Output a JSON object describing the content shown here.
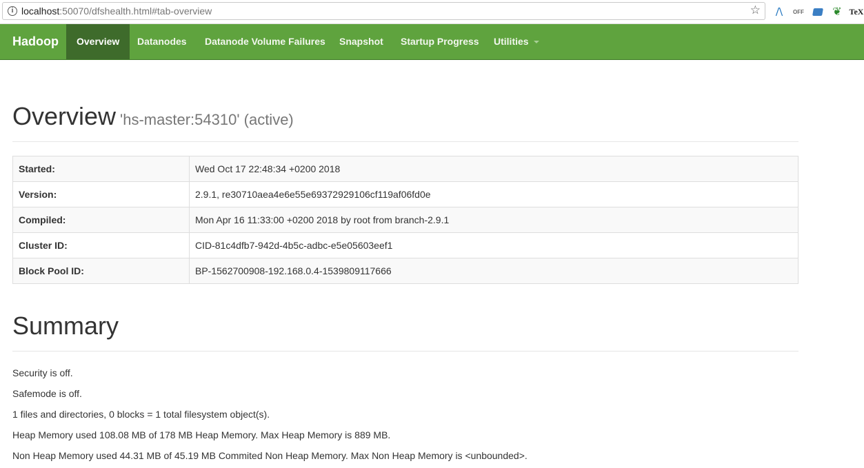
{
  "browser": {
    "url_host": "localhost",
    "url_rest": ":50070/dfshealth.html#tab-overview",
    "extensions": [
      "mendeley-icon",
      "office-icon",
      "zotero-icon",
      "evernote-icon",
      "tex-icon"
    ],
    "ext_text": {
      "office": "OFF",
      "tex": "TeX",
      "mendeley": "/\\"
    }
  },
  "navbar": {
    "brand": "Hadoop",
    "items": [
      {
        "label": "Overview",
        "active": true
      },
      {
        "label": "Datanodes"
      },
      {
        "label": "Datanode Volume Failures"
      },
      {
        "label": "Snapshot"
      },
      {
        "label": "Startup Progress"
      },
      {
        "label": "Utilities",
        "dropdown": true
      }
    ],
    "color": "#5fa33e",
    "active_color": "#3e6b2b"
  },
  "overview": {
    "title": "Overview",
    "subtitle": "'hs-master:54310' (active)",
    "rows": [
      {
        "key": "Started:",
        "value": "Wed Oct 17 22:48:34 +0200 2018"
      },
      {
        "key": "Version:",
        "value": "2.9.1, re30710aea4e6e55e69372929106cf119af06fd0e"
      },
      {
        "key": "Compiled:",
        "value": "Mon Apr 16 11:33:00 +0200 2018 by root from branch-2.9.1"
      },
      {
        "key": "Cluster ID:",
        "value": "CID-81c4dfb7-942d-4b5c-adbc-e5e05603eef1"
      },
      {
        "key": "Block Pool ID:",
        "value": "BP-1562700908-192.168.0.4-1539809117666"
      }
    ]
  },
  "summary": {
    "title": "Summary",
    "lines": [
      "Security is off.",
      "Safemode is off.",
      "1 files and directories, 0 blocks = 1 total filesystem object(s).",
      "Heap Memory used 108.08 MB of 178 MB Heap Memory. Max Heap Memory is 889 MB.",
      "Non Heap Memory used 44.31 MB of 45.19 MB Commited Non Heap Memory. Max Non Heap Memory is <unbounded>."
    ]
  }
}
